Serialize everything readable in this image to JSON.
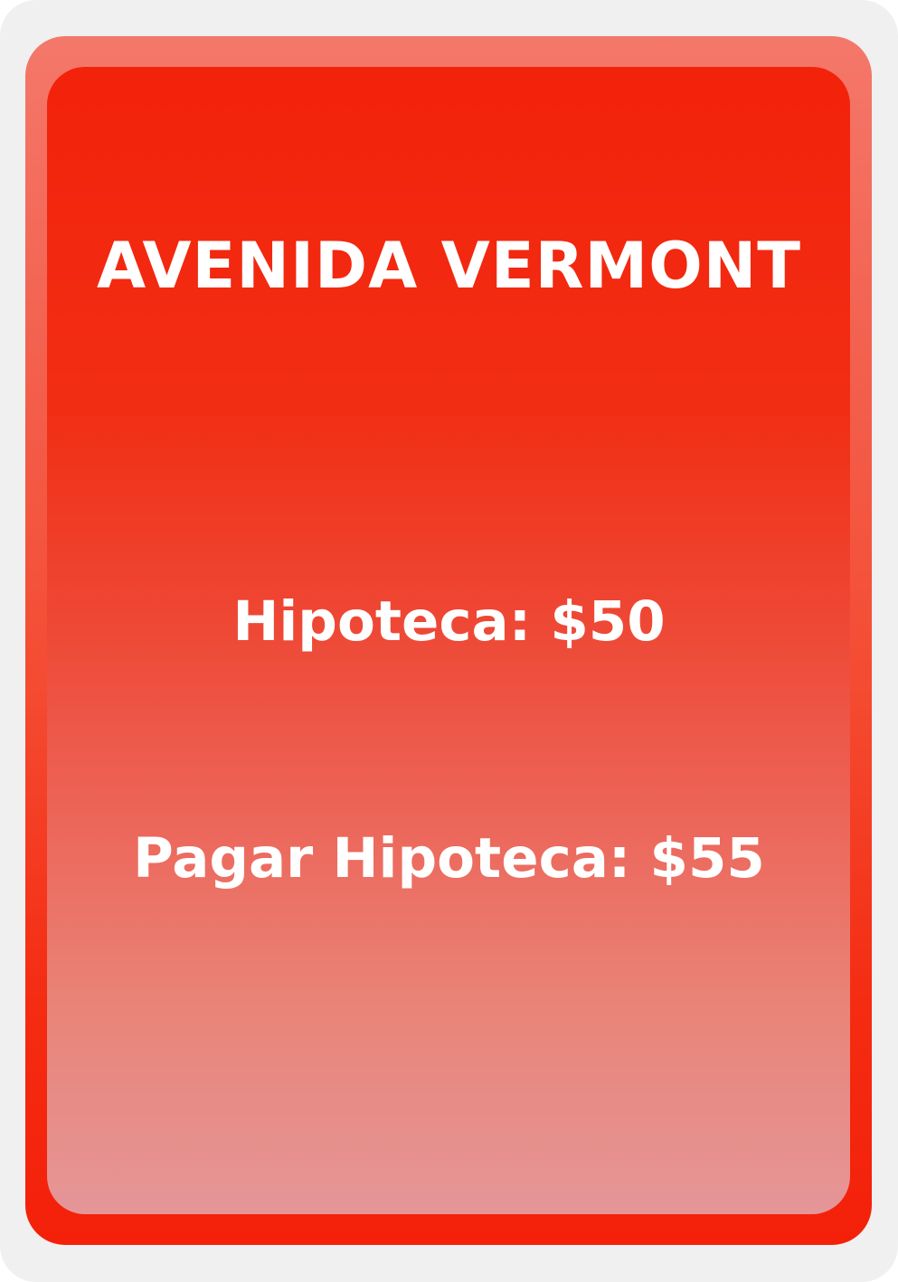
{
  "card": {
    "title": "AVENIDA VERMONT",
    "mortgage": "Hipoteca: $50",
    "unmortgage": "Pagar Hipoteca: $55",
    "colors": {
      "background": "#f0f0f0",
      "border": "#f4786a",
      "fill_top": "#f3220a",
      "fill_bottom": "#e59698",
      "text": "#ffffff"
    }
  }
}
